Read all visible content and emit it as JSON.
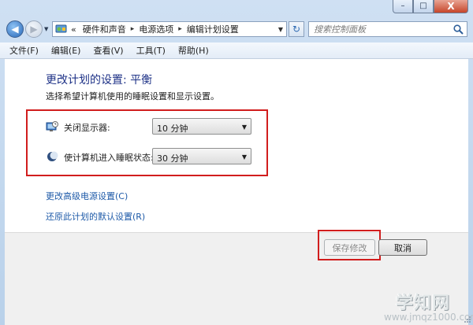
{
  "window": {
    "controls": {
      "minimize": "–",
      "maximize": "□",
      "close": "X"
    }
  },
  "address_bar": {
    "back": "◀",
    "forward": "▶",
    "recent": "▼",
    "chevron": "«",
    "breadcrumbs": [
      "硬件和声音",
      "电源选项",
      "编辑计划设置"
    ],
    "separator": "▸",
    "dropdown": "▼",
    "refresh": "↻",
    "search_placeholder": "搜索控制面板"
  },
  "menu": {
    "items": [
      "文件(F)",
      "编辑(E)",
      "查看(V)",
      "工具(T)",
      "帮助(H)"
    ]
  },
  "main": {
    "title": "更改计划的设置: 平衡",
    "subtitle": "选择希望计算机使用的睡眠设置和显示设置。",
    "settings": [
      {
        "label": "关闭显示器:",
        "value": "10 分钟",
        "icon": "monitor-clock-icon"
      },
      {
        "label": "使计算机进入睡眠状态:",
        "value": "30 分钟",
        "icon": "moon-icon"
      }
    ],
    "dropdown_arrow": "▼",
    "links": [
      "更改高级电源设置(C)",
      "还原此计划的默认设置(R)"
    ]
  },
  "footer": {
    "save_label": "保存修改",
    "cancel_label": "取消"
  },
  "watermark": {
    "main": "学知网",
    "url": "www.jmqz1000.com"
  },
  "colors": {
    "title_blue": "#1e3287",
    "link_blue": "#1e5aa8",
    "highlight_red": "#d11d1d"
  }
}
